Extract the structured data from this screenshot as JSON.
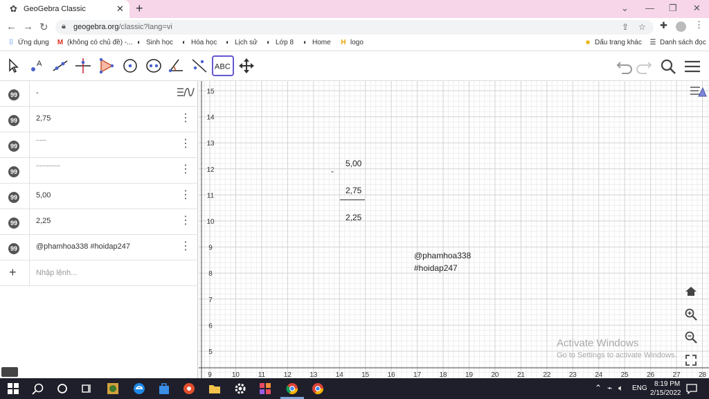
{
  "browser": {
    "tab_title": "GeoGebra Classic",
    "url_host": "geogebra.org",
    "url_path": "/classic?lang=vi"
  },
  "bookmarks": {
    "apps": "Ứng dụng",
    "gmail": "(không có chủ đề) -...",
    "sinh_hoc": "Sinh học",
    "hoa_hoc": "Hóa học",
    "lich_su": "Lịch sử",
    "lop8": "Lớp 8",
    "home": "Home",
    "logo": "logo",
    "other": "Dấu trang khác",
    "reading_list": "Danh sách đọc"
  },
  "algebra": {
    "rows": [
      {
        "value": "-"
      },
      {
        "value": "2,75"
      },
      {
        "value": "......"
      },
      {
        "value": ".............."
      },
      {
        "value": "5,00"
      },
      {
        "value": "2,25"
      },
      {
        "value": "@phamhoa338  #hoidap247"
      }
    ],
    "input_placeholder": "Nhập lệnh..."
  },
  "graphics": {
    "x_ticks": [
      "9",
      "10",
      "11",
      "12",
      "13",
      "14",
      "15",
      "16",
      "17",
      "18",
      "19",
      "20",
      "21",
      "22",
      "23",
      "24",
      "25",
      "26",
      "27",
      "28"
    ],
    "y_ticks": [
      "15",
      "14",
      "13",
      "12",
      "11",
      "10",
      "9",
      "8",
      "7",
      "6",
      "5"
    ],
    "dash_text": "-",
    "num_top": "5,00",
    "num_mid": "2,75",
    "num_bottom": "2,25",
    "credit_line1": "@phamhoa338",
    "credit_line2": "#hoidap247"
  },
  "watermark": {
    "title": "Activate Windows",
    "subtitle": "Go to Settings to activate Windows."
  },
  "taskbar": {
    "lang": "ENG",
    "time": "8:19 PM",
    "date": "2/15/2022"
  }
}
